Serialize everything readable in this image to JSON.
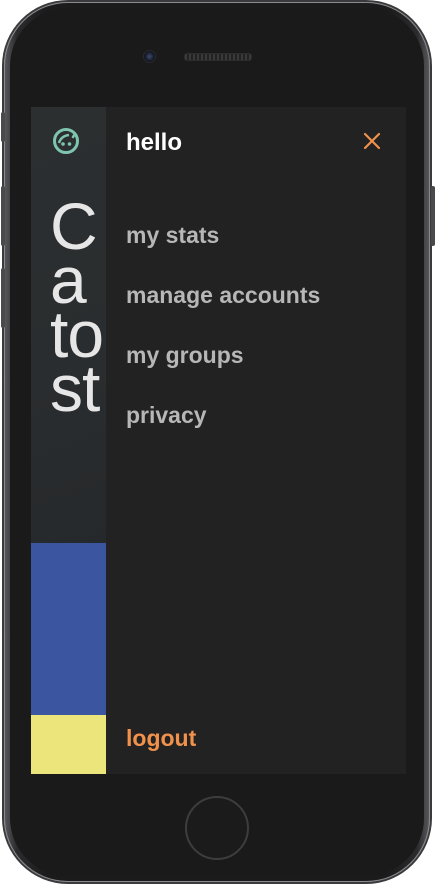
{
  "drawer": {
    "title": "hello",
    "close_icon": "close-icon",
    "items": [
      {
        "label": "my stats"
      },
      {
        "label": "manage accounts"
      },
      {
        "label": "my groups"
      },
      {
        "label": "privacy"
      }
    ],
    "logout_label": "logout"
  },
  "background_app": {
    "logo_icon": "face-logo-icon",
    "headline_lines": [
      "C",
      "a",
      "to",
      "st"
    ]
  },
  "colors": {
    "accent": "#f1914c",
    "drawer_bg": "#222222",
    "menu_text": "#b7b7b7",
    "title_text": "#ffffff",
    "logo": "#7fc4b0",
    "blue_block": "#3c55a0",
    "yellow_block": "#ece57b"
  }
}
